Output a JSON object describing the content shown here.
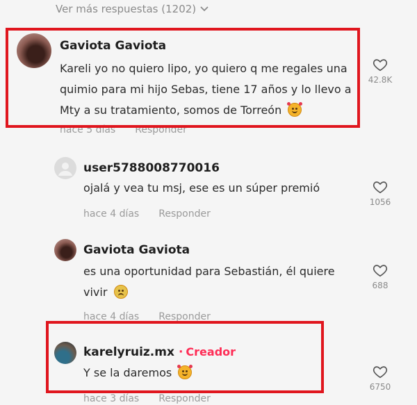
{
  "more_replies": {
    "label": "Ver más respuestas (1202)"
  },
  "comments": [
    {
      "username": "Gaviota Gaviota",
      "lines": [
        "Kareli yo no quiero lipo, yo quiero q me regales una",
        "quimio para mi hijo Sebas, tiene 17 años y lo llevo a",
        "Mty a su tratamiento, somos de Torreón"
      ],
      "time": "hace 5 días",
      "reply": "Responder",
      "likes": "42.8K"
    },
    {
      "username": "user5788008770016",
      "lines": [
        "ojalá y vea tu msj, ese es un súper premió"
      ],
      "time": "hace 4 días",
      "reply": "Responder",
      "likes": "1056"
    },
    {
      "username": "Gaviota Gaviota",
      "lines": [
        "es una oportunidad para Sebastián, él quiere",
        "vivir"
      ],
      "time": "hace 4 días",
      "reply": "Responder",
      "likes": "688"
    },
    {
      "username": "karelyruiz.mx",
      "dot": "·",
      "badge": "Creador",
      "lines": [
        "Y se la daremos"
      ],
      "time": "hace 3 días",
      "reply": "Responder",
      "likes": "6750"
    }
  ],
  "colors": {
    "highlight": "#e0161e",
    "creator": "#fe2c55",
    "muted": "#9a9a9a"
  },
  "icons": [
    "chevron-down-icon",
    "heart-outline-icon",
    "default-avatar-icon",
    "smiling-face-with-hearts-emoji",
    "sad-face-emoji"
  ]
}
